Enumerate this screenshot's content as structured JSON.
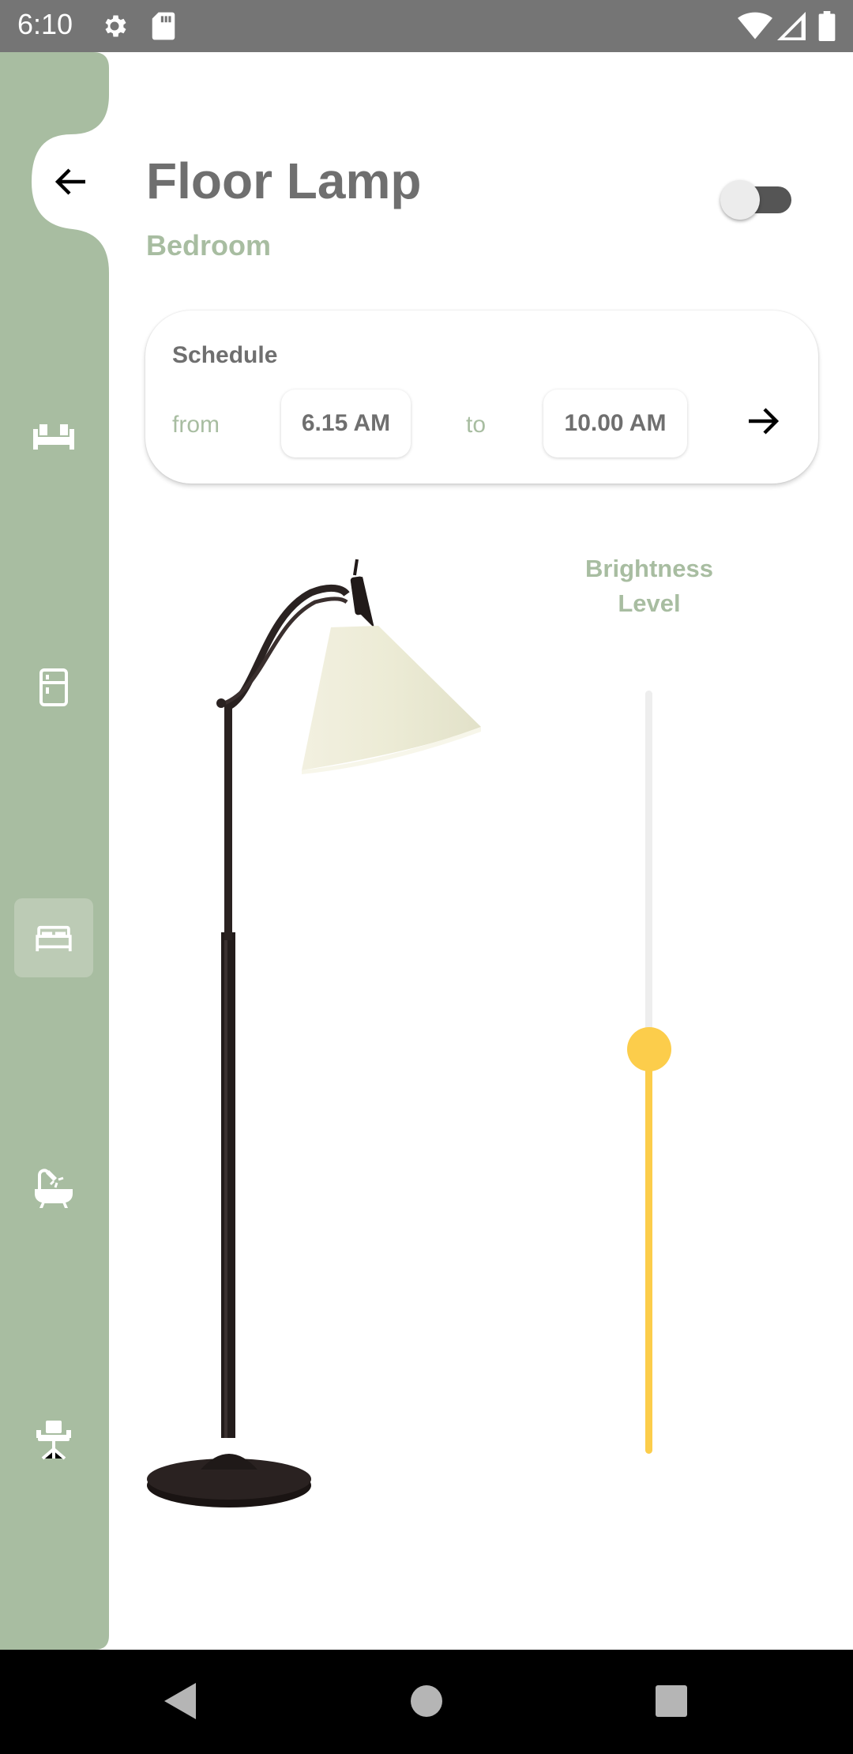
{
  "status_bar": {
    "time": "6:10",
    "icons": [
      "settings-icon",
      "sd-card-icon",
      "wifi-icon",
      "signal-icon",
      "battery-icon"
    ]
  },
  "sidebar": {
    "back_icon": "arrow-back-icon",
    "items": [
      {
        "icon": "sofa-icon",
        "active": false
      },
      {
        "icon": "fridge-icon",
        "active": false
      },
      {
        "icon": "bed-icon",
        "active": true
      },
      {
        "icon": "bathtub-icon",
        "active": false
      },
      {
        "icon": "office-chair-icon",
        "active": false
      }
    ]
  },
  "header": {
    "title": "Floor Lamp",
    "subtitle": "Bedroom",
    "power_toggle_on": false
  },
  "schedule": {
    "title": "Schedule",
    "from_label": "from",
    "from_time": "6.15 AM",
    "to_label": "to",
    "to_time": "10.00 AM",
    "arrow_icon": "arrow-forward-icon"
  },
  "brightness": {
    "label_line1": "Brightness",
    "label_line2": "Level",
    "level_fraction": 0.53
  },
  "colors": {
    "sidebar_green": "#a8bda1",
    "active_item": "#bccbb5",
    "accent_yellow": "#fccd4b",
    "title_gray": "#6f6f6f"
  }
}
